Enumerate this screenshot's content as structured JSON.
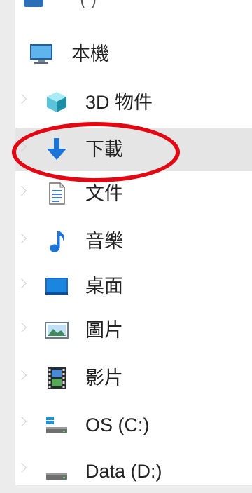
{
  "nav": {
    "top_partial_label": "( )",
    "this_pc": {
      "label": "本機",
      "icon": "monitor-icon"
    },
    "items": [
      {
        "label": "3D 物件",
        "icon": "3d-objects-icon"
      },
      {
        "label": "下載",
        "icon": "download-arrow-icon",
        "selected": true
      },
      {
        "label": "文件",
        "icon": "document-icon"
      },
      {
        "label": "音樂",
        "icon": "music-note-icon"
      },
      {
        "label": "桌面",
        "icon": "desktop-icon"
      },
      {
        "label": "圖片",
        "icon": "pictures-icon"
      },
      {
        "label": "影片",
        "icon": "videos-icon"
      },
      {
        "label": "OS (C:)",
        "icon": "os-drive-icon"
      },
      {
        "label": "Data (D:)",
        "icon": "drive-icon"
      }
    ]
  },
  "colors": {
    "highlight_circle": "#e30613",
    "selection": "#e5e5e5",
    "accent_blue": "#1c73d8"
  }
}
